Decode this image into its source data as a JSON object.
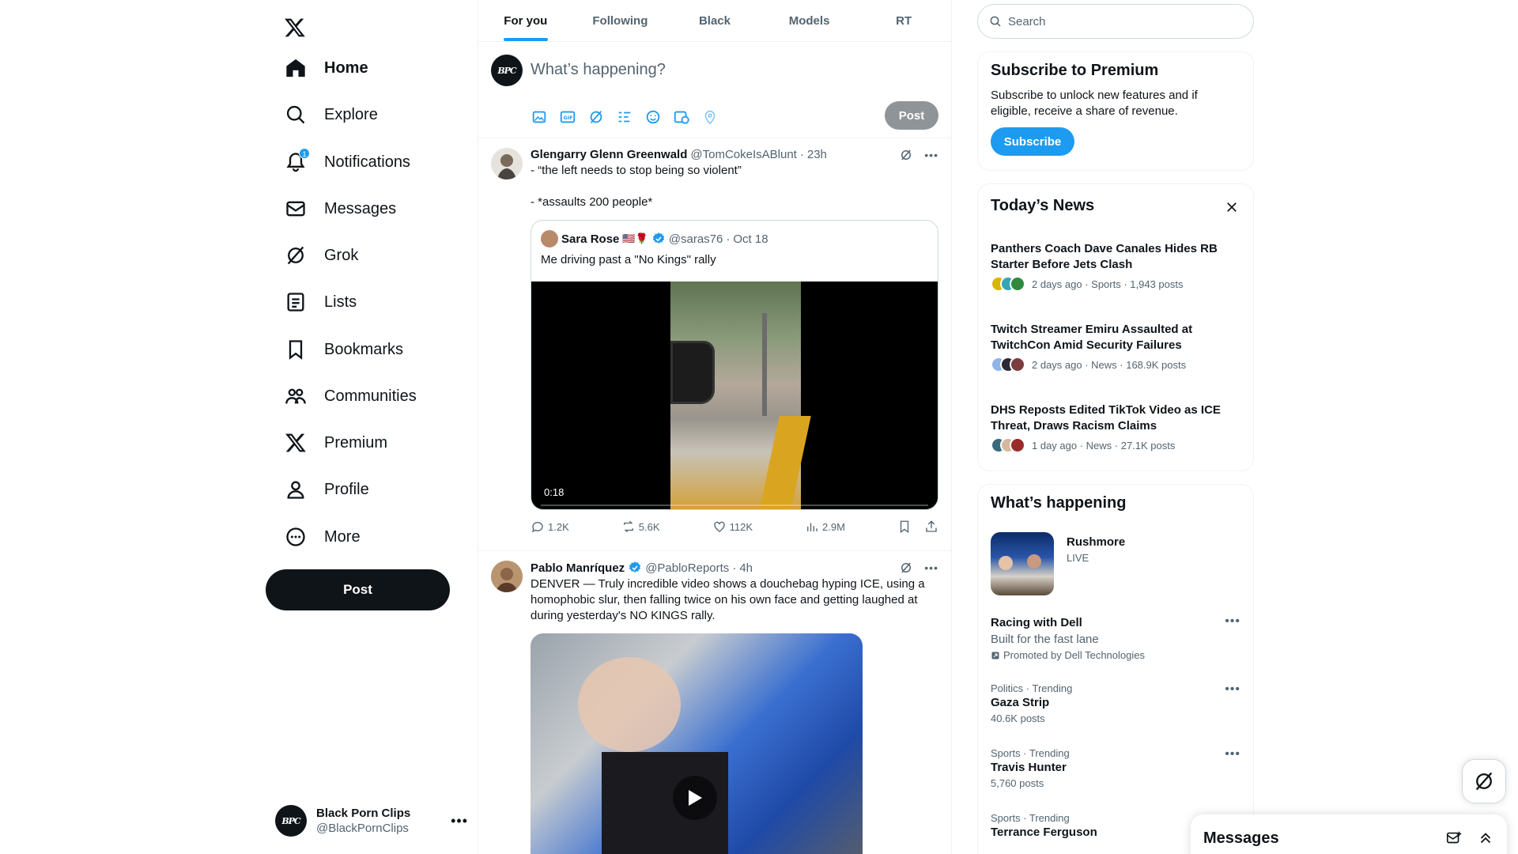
{
  "nav": {
    "items": [
      {
        "label": "Home",
        "icon": "home-icon",
        "active": true
      },
      {
        "label": "Explore",
        "icon": "search-icon"
      },
      {
        "label": "Notifications",
        "icon": "bell-icon",
        "badge": "1"
      },
      {
        "label": "Messages",
        "icon": "envelope-icon"
      },
      {
        "label": "Grok",
        "icon": "grok-icon"
      },
      {
        "label": "Lists",
        "icon": "list-icon"
      },
      {
        "label": "Bookmarks",
        "icon": "bookmark-icon"
      },
      {
        "label": "Communities",
        "icon": "people-icon"
      },
      {
        "label": "Premium",
        "icon": "x-logo-icon"
      },
      {
        "label": "Profile",
        "icon": "person-icon"
      },
      {
        "label": "More",
        "icon": "more-circle-icon"
      }
    ],
    "post_label": "Post",
    "account": {
      "avatar_text": "BPC",
      "name": "Black Porn Clips",
      "handle": "@BlackPornClips"
    }
  },
  "tabs": [
    {
      "label": "For you",
      "active": true
    },
    {
      "label": "Following"
    },
    {
      "label": "Black"
    },
    {
      "label": "Models"
    },
    {
      "label": "RT"
    }
  ],
  "composer": {
    "placeholder": "What’s happening?",
    "post_label": "Post"
  },
  "tweets": [
    {
      "name": "Glengarry Glenn Greenwald",
      "handle": "@TomCokeIsABlunt",
      "time": "23h",
      "text1": "- “the left needs to stop being so violent”",
      "text2": "- *assaults 200 people*",
      "quote": {
        "name": "Sara Rose",
        "emoji": "🇺🇸🌹",
        "handle": "@saras76",
        "time": "Oct 18",
        "text": "Me driving past a \"No Kings\" rally",
        "video_duration": "0:18"
      },
      "stats": {
        "replies": "1.2K",
        "reposts": "5.6K",
        "likes": "112K",
        "views": "2.9M"
      }
    },
    {
      "name": "Pablo Manríquez",
      "handle": "@PabloReports",
      "time": "4h",
      "text": "DENVER — Truly incredible video shows a douchebag hyping ICE, using a homophobic slur, then falling twice on his own face and getting laughed at during yesterday's NO KINGS rally."
    }
  ],
  "search": {
    "placeholder": "Search"
  },
  "premium": {
    "title": "Subscribe to Premium",
    "text": "Subscribe to unlock new features and if eligible, receive a share of revenue.",
    "button": "Subscribe"
  },
  "news": {
    "title": "Today’s News",
    "items": [
      {
        "title": "Panthers Coach Dave Canales Hides RB Starter Before Jets Clash",
        "meta": "2 days ago · Sports · 1,943 posts"
      },
      {
        "title": "Twitch Streamer Emiru Assaulted at TwitchCon Amid Security Failures",
        "meta": "2 days ago · News · 168.9K posts"
      },
      {
        "title": "DHS Reposts Edited TikTok Video as ICE Threat, Draws Racism Claims",
        "meta": "1 day ago · News · 27.1K posts"
      }
    ]
  },
  "happening": {
    "title": "What’s happening",
    "live": {
      "title": "Rushmore",
      "status": "LIVE"
    },
    "promo": {
      "title": "Racing with Dell",
      "subtitle": "Built for the fast lane",
      "promoted": "Promoted by Dell Technologies"
    },
    "trends": [
      {
        "category": "Politics · Trending",
        "title": "Gaza Strip",
        "count": "40.6K posts"
      },
      {
        "category": "Sports · Trending",
        "title": "Travis Hunter",
        "count": "5,760 posts"
      },
      {
        "category": "Sports · Trending",
        "title": "Terrance Ferguson",
        "count": ""
      }
    ]
  },
  "messages_drawer": {
    "title": "Messages"
  },
  "colors": {
    "accent": "#1d9bf0",
    "text": "#0f1419",
    "muted": "#536471",
    "border": "#eff3f4"
  }
}
